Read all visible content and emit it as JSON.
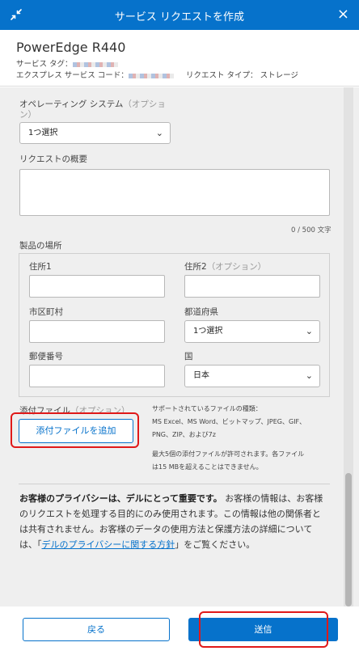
{
  "dialog": {
    "title": "サービス リクエストを作成",
    "close_glyph": "×"
  },
  "header": {
    "product": "PowerEdge R440",
    "service_tag_label": "サービス タグ：",
    "express_code_label": "エクスプレス サービス コード：",
    "request_type_label": "リクエスト タイプ：",
    "request_type_value": "ストレージ"
  },
  "form": {
    "os_label": "オペレーティング システム",
    "os_optional": "（オプショ",
    "os_optional_cont": "ン）",
    "os_select_value": "1つ選択",
    "summary_label": "リクエストの概要",
    "summary_value": "",
    "summary_counter": "0 / 500 文字",
    "location_label": "製品の場所",
    "address1_label": "住所1",
    "address2_label": "住所2",
    "address2_optional": "（オプション）",
    "city_label": "市区町村",
    "prefecture_label": "都道府県",
    "prefecture_value": "1つ選択",
    "postal_label": "郵便番号",
    "country_label": "国",
    "country_value": "日本",
    "attach_label": "添付ファイル",
    "attach_optional": "（オプション）",
    "attach_button": "添付ファイルを追加",
    "supported_title": "サポートされているファイルの種類：",
    "supported_line1": "MS Excel、MS Word、ビットマップ、JPEG、GIF、",
    "supported_line2": "PNG、ZIP、および7z",
    "max_line1": "最大5個の添付ファイルが許可されます。各ファイル",
    "max_line2": "は15 MBを超えることはできません。"
  },
  "privacy": {
    "bold": "お客様のプライバシーは、デルにとって重要です。",
    "text1": " お客様の情報は、お客様のリクエストを処理する目的にのみ使用されます。この情報は他の関係者とは共有されません。お客様のデータの使用方法と保護方法の詳細については、「",
    "link": "デルのプライバシーに関する方針",
    "text2": "」をご覧ください。"
  },
  "footer": {
    "back": "戻る",
    "submit": "送信"
  },
  "colors": {
    "accent": "#0672cb",
    "highlight": "#e01919"
  }
}
